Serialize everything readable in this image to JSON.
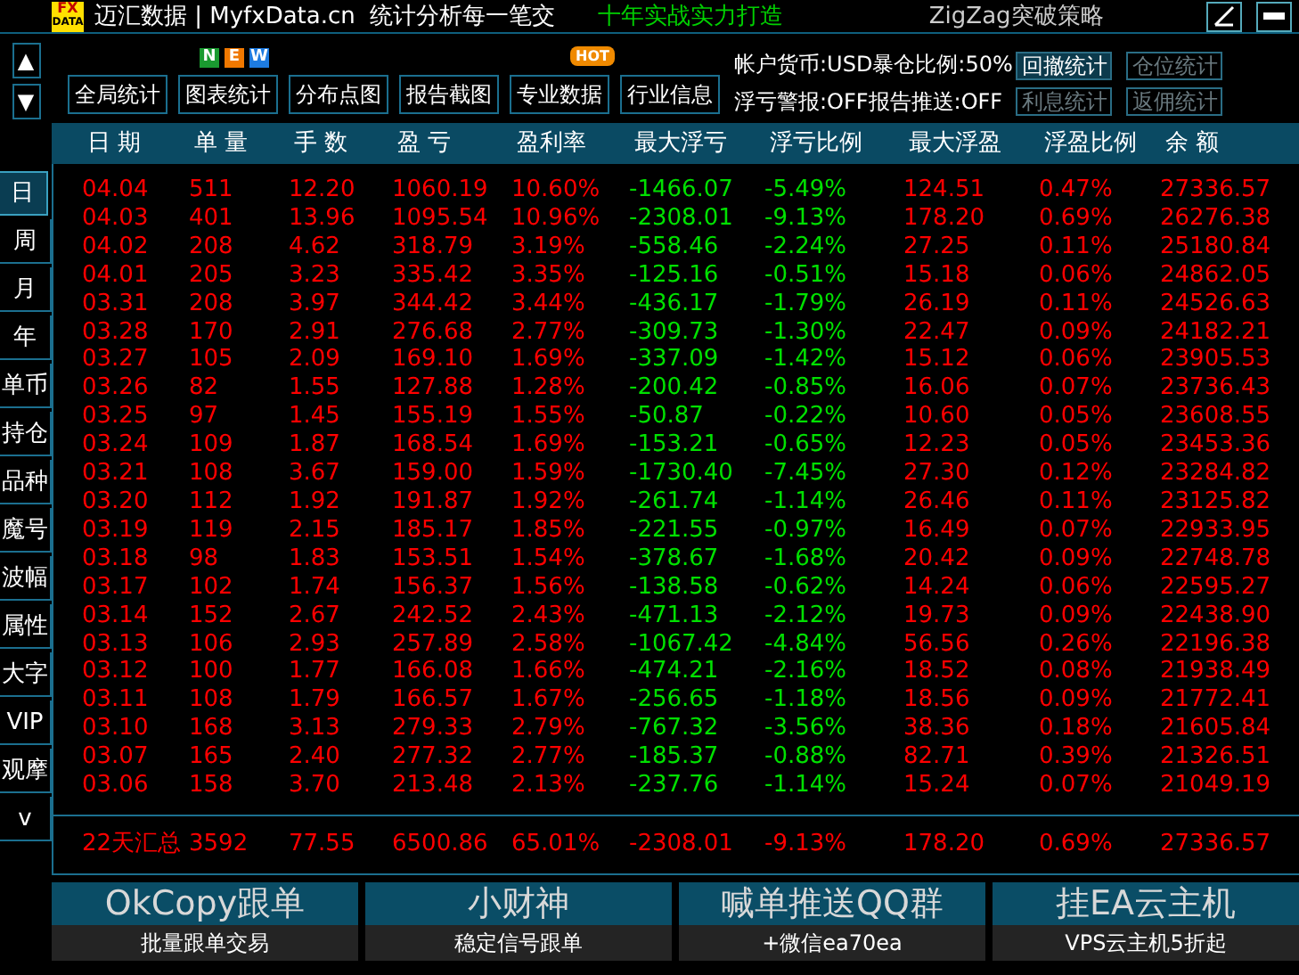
{
  "top_bar": {
    "logo": {
      "line_1": "FX",
      "line_2": "DATA"
    },
    "brand": "迈汇数据 | MyfxData.cn",
    "tagline": "统计分析每一笔交",
    "slogan": "十年实战实力打造",
    "strategy": "ZigZag突破策略"
  },
  "scroll_buttons": [
    "▲",
    "▼"
  ],
  "tabs": [
    {
      "label": "全局统计"
    },
    {
      "label": "图表统计",
      "badge": {
        "kind": "new",
        "letters": [
          "N",
          "E",
          "W"
        ]
      }
    },
    {
      "label": "分布点图"
    },
    {
      "label": "报告截图"
    },
    {
      "label": "专业数据",
      "badge": {
        "kind": "hot",
        "letters": [
          "HOT"
        ]
      }
    },
    {
      "label": "行业信息"
    }
  ],
  "info": [
    "帐户货币:USD暴仓比例:50%",
    "浮亏警报:OFF报告推送:OFF"
  ],
  "side_buttons": [
    {
      "label": "回撤统计",
      "disabled": false
    },
    {
      "label": "仓位统计",
      "disabled": true
    },
    {
      "label": "利息统计",
      "disabled": true
    },
    {
      "label": "返佣统计",
      "disabled": true
    }
  ],
  "sidebar": [
    {
      "label": "日",
      "selected": true
    },
    {
      "label": "周",
      "selected": false
    },
    {
      "label": "月",
      "selected": false
    },
    {
      "label": "年",
      "selected": false
    },
    {
      "label": "单币",
      "selected": false
    },
    {
      "label": "持仓",
      "selected": false
    },
    {
      "label": "品种",
      "selected": false
    },
    {
      "label": "魔号",
      "selected": false
    },
    {
      "label": "波幅",
      "selected": false
    },
    {
      "label": "属性",
      "selected": false
    },
    {
      "label": "大字",
      "selected": false
    },
    {
      "label": "VIP",
      "selected": false
    },
    {
      "label": "观摩",
      "selected": false
    },
    {
      "label": "v",
      "selected": false
    }
  ],
  "table": {
    "columns": [
      {
        "label": "日 期",
        "color": "#ff0000"
      },
      {
        "label": "单 量",
        "color": "#ff0000"
      },
      {
        "label": "手 数",
        "color": "#ff0000"
      },
      {
        "label": "盈 亏",
        "color": "#ff0000"
      },
      {
        "label": "盈利率",
        "color": "#ff0000"
      },
      {
        "label": "最大浮亏",
        "color": "#00e000"
      },
      {
        "label": "浮亏比例",
        "color": "#00e000"
      },
      {
        "label": "最大浮盈",
        "color": "#ff0000"
      },
      {
        "label": "浮盈比例",
        "color": "#ff0000"
      },
      {
        "label": "余 额",
        "color": "#ff0000"
      }
    ],
    "rows": [
      [
        "04.04",
        "511",
        "12.20",
        "1060.19",
        "10.60%",
        "-1466.07",
        "-5.49%",
        "124.51",
        "0.47%",
        "27336.57"
      ],
      [
        "04.03",
        "401",
        "13.96",
        "1095.54",
        "10.96%",
        "-2308.01",
        "-9.13%",
        "178.20",
        "0.69%",
        "26276.38"
      ],
      [
        "04.02",
        "208",
        "4.62",
        "318.79",
        "3.19%",
        "-558.46",
        "-2.24%",
        "27.25",
        "0.11%",
        "25180.84"
      ],
      [
        "04.01",
        "205",
        "3.23",
        "335.42",
        "3.35%",
        "-125.16",
        "-0.51%",
        "15.18",
        "0.06%",
        "24862.05"
      ],
      [
        "03.31",
        "208",
        "3.97",
        "344.42",
        "3.44%",
        "-436.17",
        "-1.79%",
        "26.19",
        "0.11%",
        "24526.63"
      ],
      [
        "03.28",
        "170",
        "2.91",
        "276.68",
        "2.77%",
        "-309.73",
        "-1.30%",
        "22.47",
        "0.09%",
        "24182.21"
      ],
      [
        "03.27",
        "105",
        "2.09",
        "169.10",
        "1.69%",
        "-337.09",
        "-1.42%",
        "15.12",
        "0.06%",
        "23905.53"
      ],
      [
        "03.26",
        "82",
        "1.55",
        "127.88",
        "1.28%",
        "-200.42",
        "-0.85%",
        "16.06",
        "0.07%",
        "23736.43"
      ],
      [
        "03.25",
        "97",
        "1.45",
        "155.19",
        "1.55%",
        "-50.87",
        "-0.22%",
        "10.60",
        "0.05%",
        "23608.55"
      ],
      [
        "03.24",
        "109",
        "1.87",
        "168.54",
        "1.69%",
        "-153.21",
        "-0.65%",
        "12.23",
        "0.05%",
        "23453.36"
      ],
      [
        "03.21",
        "108",
        "3.67",
        "159.00",
        "1.59%",
        "-1730.40",
        "-7.45%",
        "27.30",
        "0.12%",
        "23284.82"
      ],
      [
        "03.20",
        "112",
        "1.92",
        "191.87",
        "1.92%",
        "-261.74",
        "-1.14%",
        "26.46",
        "0.11%",
        "23125.82"
      ],
      [
        "03.19",
        "119",
        "2.15",
        "185.17",
        "1.85%",
        "-221.55",
        "-0.97%",
        "16.49",
        "0.07%",
        "22933.95"
      ],
      [
        "03.18",
        "98",
        "1.83",
        "153.51",
        "1.54%",
        "-378.67",
        "-1.68%",
        "20.42",
        "0.09%",
        "22748.78"
      ],
      [
        "03.17",
        "102",
        "1.74",
        "156.37",
        "1.56%",
        "-138.58",
        "-0.62%",
        "14.24",
        "0.06%",
        "22595.27"
      ],
      [
        "03.14",
        "152",
        "2.67",
        "242.52",
        "2.43%",
        "-471.13",
        "-2.12%",
        "19.73",
        "0.09%",
        "22438.90"
      ],
      [
        "03.13",
        "106",
        "2.93",
        "257.89",
        "2.58%",
        "-1067.42",
        "-4.84%",
        "56.56",
        "0.26%",
        "22196.38"
      ],
      [
        "03.12",
        "100",
        "1.77",
        "166.08",
        "1.66%",
        "-474.21",
        "-2.16%",
        "18.52",
        "0.08%",
        "21938.49"
      ],
      [
        "03.11",
        "108",
        "1.79",
        "166.57",
        "1.67%",
        "-256.65",
        "-1.18%",
        "18.56",
        "0.09%",
        "21772.41"
      ],
      [
        "03.10",
        "168",
        "3.13",
        "279.33",
        "2.79%",
        "-767.32",
        "-3.56%",
        "38.36",
        "0.18%",
        "21605.84"
      ],
      [
        "03.07",
        "165",
        "2.40",
        "277.32",
        "2.77%",
        "-185.37",
        "-0.88%",
        "82.71",
        "0.39%",
        "21326.51"
      ],
      [
        "03.06",
        "158",
        "3.70",
        "213.48",
        "2.13%",
        "-237.76",
        "-1.14%",
        "15.24",
        "0.07%",
        "21049.19"
      ]
    ],
    "summary": {
      "color": "#ff0000",
      "cells": [
        "22天汇总",
        "3592",
        "77.55",
        "6500.86",
        "65.01%",
        "-2308.01",
        "-9.13%",
        "178.20",
        "0.69%",
        "27336.57"
      ]
    }
  },
  "promos": [
    {
      "title": "OkCopy跟单",
      "subtitle": "批量跟单交易"
    },
    {
      "title": "小财神",
      "subtitle": "稳定信号跟单"
    },
    {
      "title": "喊单推送QQ群",
      "subtitle": "+微信ea70ea"
    },
    {
      "title": "挂EA云主机",
      "subtitle": "VPS云主机5折起"
    }
  ]
}
